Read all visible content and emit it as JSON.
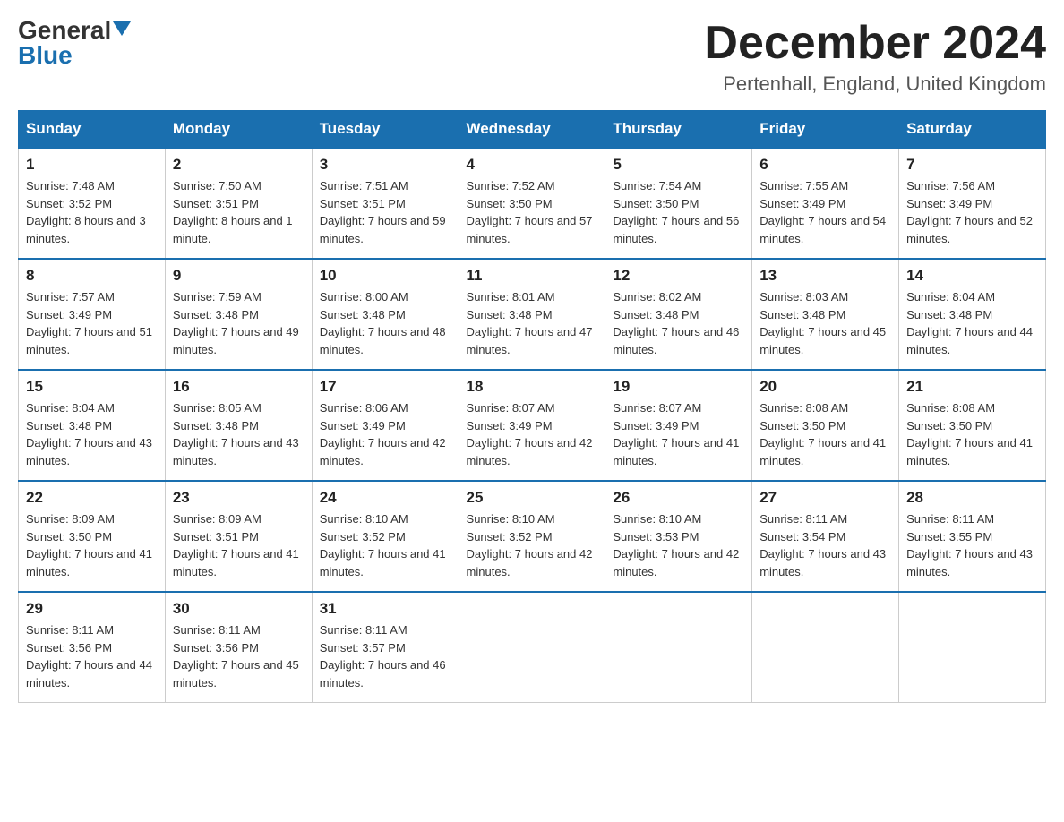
{
  "header": {
    "logo_general": "General",
    "logo_blue": "Blue",
    "month_year": "December 2024",
    "location": "Pertenhall, England, United Kingdom"
  },
  "days_of_week": [
    "Sunday",
    "Monday",
    "Tuesday",
    "Wednesday",
    "Thursday",
    "Friday",
    "Saturday"
  ],
  "weeks": [
    [
      {
        "day": "1",
        "sunrise": "7:48 AM",
        "sunset": "3:52 PM",
        "daylight": "8 hours and 3 minutes."
      },
      {
        "day": "2",
        "sunrise": "7:50 AM",
        "sunset": "3:51 PM",
        "daylight": "8 hours and 1 minute."
      },
      {
        "day": "3",
        "sunrise": "7:51 AM",
        "sunset": "3:51 PM",
        "daylight": "7 hours and 59 minutes."
      },
      {
        "day": "4",
        "sunrise": "7:52 AM",
        "sunset": "3:50 PM",
        "daylight": "7 hours and 57 minutes."
      },
      {
        "day": "5",
        "sunrise": "7:54 AM",
        "sunset": "3:50 PM",
        "daylight": "7 hours and 56 minutes."
      },
      {
        "day": "6",
        "sunrise": "7:55 AM",
        "sunset": "3:49 PM",
        "daylight": "7 hours and 54 minutes."
      },
      {
        "day": "7",
        "sunrise": "7:56 AM",
        "sunset": "3:49 PM",
        "daylight": "7 hours and 52 minutes."
      }
    ],
    [
      {
        "day": "8",
        "sunrise": "7:57 AM",
        "sunset": "3:49 PM",
        "daylight": "7 hours and 51 minutes."
      },
      {
        "day": "9",
        "sunrise": "7:59 AM",
        "sunset": "3:48 PM",
        "daylight": "7 hours and 49 minutes."
      },
      {
        "day": "10",
        "sunrise": "8:00 AM",
        "sunset": "3:48 PM",
        "daylight": "7 hours and 48 minutes."
      },
      {
        "day": "11",
        "sunrise": "8:01 AM",
        "sunset": "3:48 PM",
        "daylight": "7 hours and 47 minutes."
      },
      {
        "day": "12",
        "sunrise": "8:02 AM",
        "sunset": "3:48 PM",
        "daylight": "7 hours and 46 minutes."
      },
      {
        "day": "13",
        "sunrise": "8:03 AM",
        "sunset": "3:48 PM",
        "daylight": "7 hours and 45 minutes."
      },
      {
        "day": "14",
        "sunrise": "8:04 AM",
        "sunset": "3:48 PM",
        "daylight": "7 hours and 44 minutes."
      }
    ],
    [
      {
        "day": "15",
        "sunrise": "8:04 AM",
        "sunset": "3:48 PM",
        "daylight": "7 hours and 43 minutes."
      },
      {
        "day": "16",
        "sunrise": "8:05 AM",
        "sunset": "3:48 PM",
        "daylight": "7 hours and 43 minutes."
      },
      {
        "day": "17",
        "sunrise": "8:06 AM",
        "sunset": "3:49 PM",
        "daylight": "7 hours and 42 minutes."
      },
      {
        "day": "18",
        "sunrise": "8:07 AM",
        "sunset": "3:49 PM",
        "daylight": "7 hours and 42 minutes."
      },
      {
        "day": "19",
        "sunrise": "8:07 AM",
        "sunset": "3:49 PM",
        "daylight": "7 hours and 41 minutes."
      },
      {
        "day": "20",
        "sunrise": "8:08 AM",
        "sunset": "3:50 PM",
        "daylight": "7 hours and 41 minutes."
      },
      {
        "day": "21",
        "sunrise": "8:08 AM",
        "sunset": "3:50 PM",
        "daylight": "7 hours and 41 minutes."
      }
    ],
    [
      {
        "day": "22",
        "sunrise": "8:09 AM",
        "sunset": "3:50 PM",
        "daylight": "7 hours and 41 minutes."
      },
      {
        "day": "23",
        "sunrise": "8:09 AM",
        "sunset": "3:51 PM",
        "daylight": "7 hours and 41 minutes."
      },
      {
        "day": "24",
        "sunrise": "8:10 AM",
        "sunset": "3:52 PM",
        "daylight": "7 hours and 41 minutes."
      },
      {
        "day": "25",
        "sunrise": "8:10 AM",
        "sunset": "3:52 PM",
        "daylight": "7 hours and 42 minutes."
      },
      {
        "day": "26",
        "sunrise": "8:10 AM",
        "sunset": "3:53 PM",
        "daylight": "7 hours and 42 minutes."
      },
      {
        "day": "27",
        "sunrise": "8:11 AM",
        "sunset": "3:54 PM",
        "daylight": "7 hours and 43 minutes."
      },
      {
        "day": "28",
        "sunrise": "8:11 AM",
        "sunset": "3:55 PM",
        "daylight": "7 hours and 43 minutes."
      }
    ],
    [
      {
        "day": "29",
        "sunrise": "8:11 AM",
        "sunset": "3:56 PM",
        "daylight": "7 hours and 44 minutes."
      },
      {
        "day": "30",
        "sunrise": "8:11 AM",
        "sunset": "3:56 PM",
        "daylight": "7 hours and 45 minutes."
      },
      {
        "day": "31",
        "sunrise": "8:11 AM",
        "sunset": "3:57 PM",
        "daylight": "7 hours and 46 minutes."
      },
      null,
      null,
      null,
      null
    ]
  ],
  "labels": {
    "sunrise_prefix": "Sunrise: ",
    "sunset_prefix": "Sunset: ",
    "daylight_prefix": "Daylight: "
  }
}
